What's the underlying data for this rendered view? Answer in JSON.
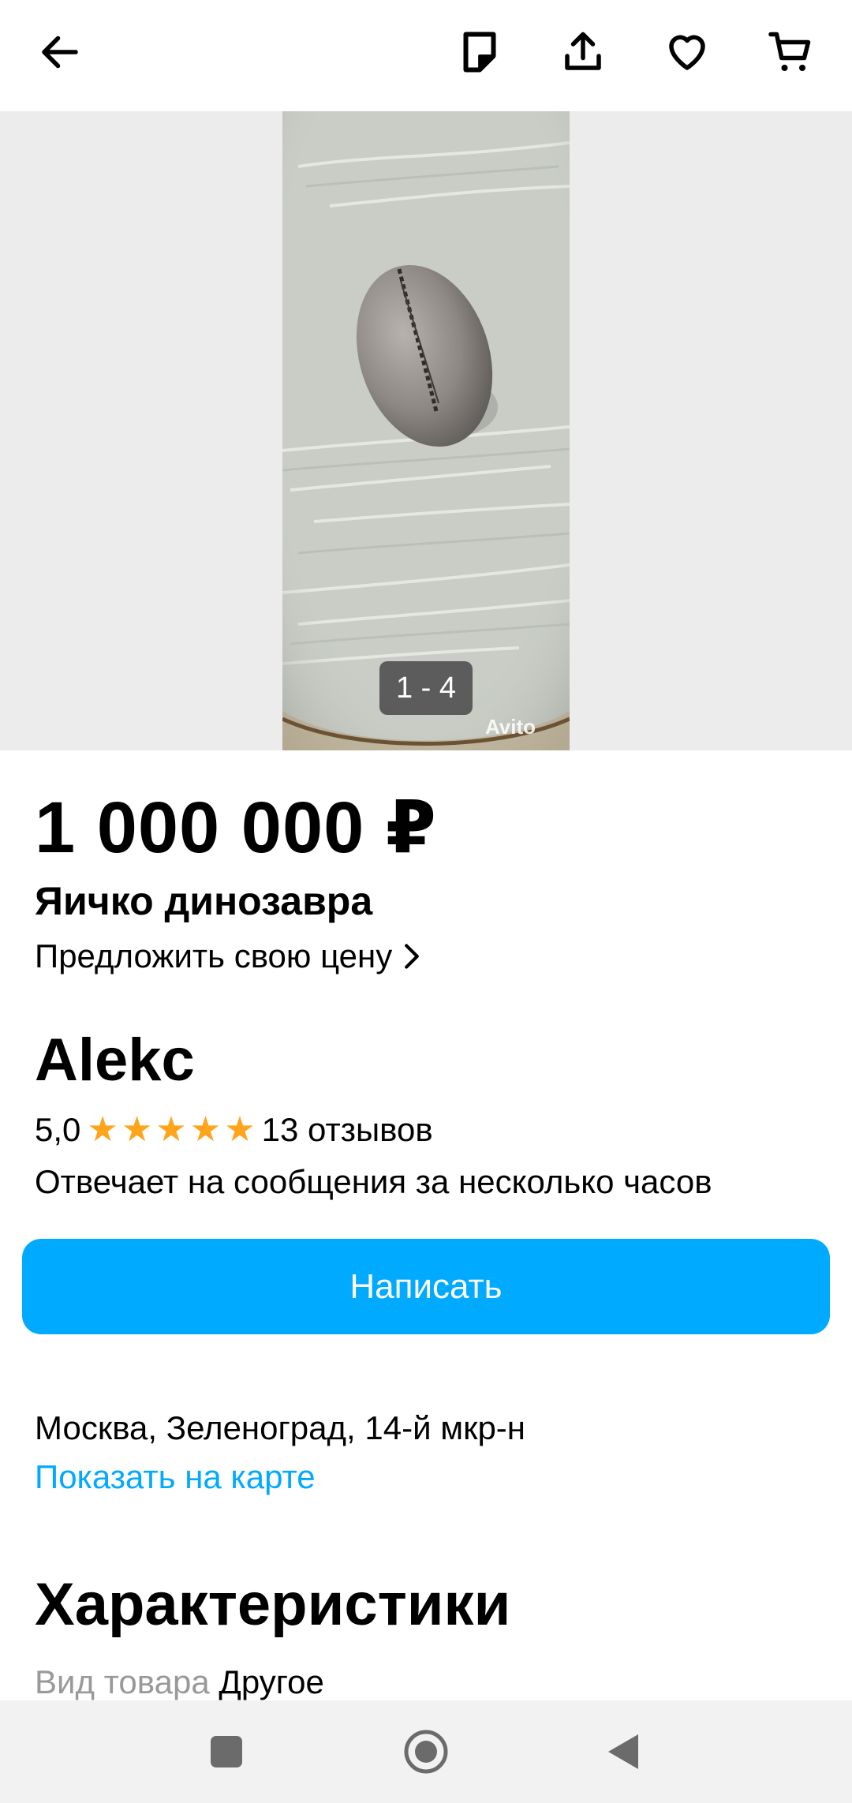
{
  "toolbar": {
    "back": "back-arrow-icon",
    "note": "note-icon",
    "share": "share-icon",
    "favorite": "heart-icon",
    "cart": "cart-icon"
  },
  "gallery": {
    "counter": "1 - 4",
    "watermark": "Avito"
  },
  "listing": {
    "price": "1 000 000 ₽",
    "title": "Яичко динозавра",
    "offer_price_link": "Предложить свою цену"
  },
  "seller": {
    "name": "Alekc",
    "rating": "5,0",
    "stars": 5,
    "reviews": "13 отзывов",
    "response_time": "Отвечает на сообщения за несколько часов",
    "message_button": "Написать"
  },
  "location": {
    "address": "Москва, Зеленоград, 14-й мкр-н",
    "map_link": "Показать на карте"
  },
  "specs": {
    "heading": "Характеристики",
    "rows": [
      {
        "key": "Вид товара",
        "value": "Другое"
      }
    ]
  },
  "colors": {
    "accent": "#00aaff",
    "star": "#ffa41b"
  }
}
